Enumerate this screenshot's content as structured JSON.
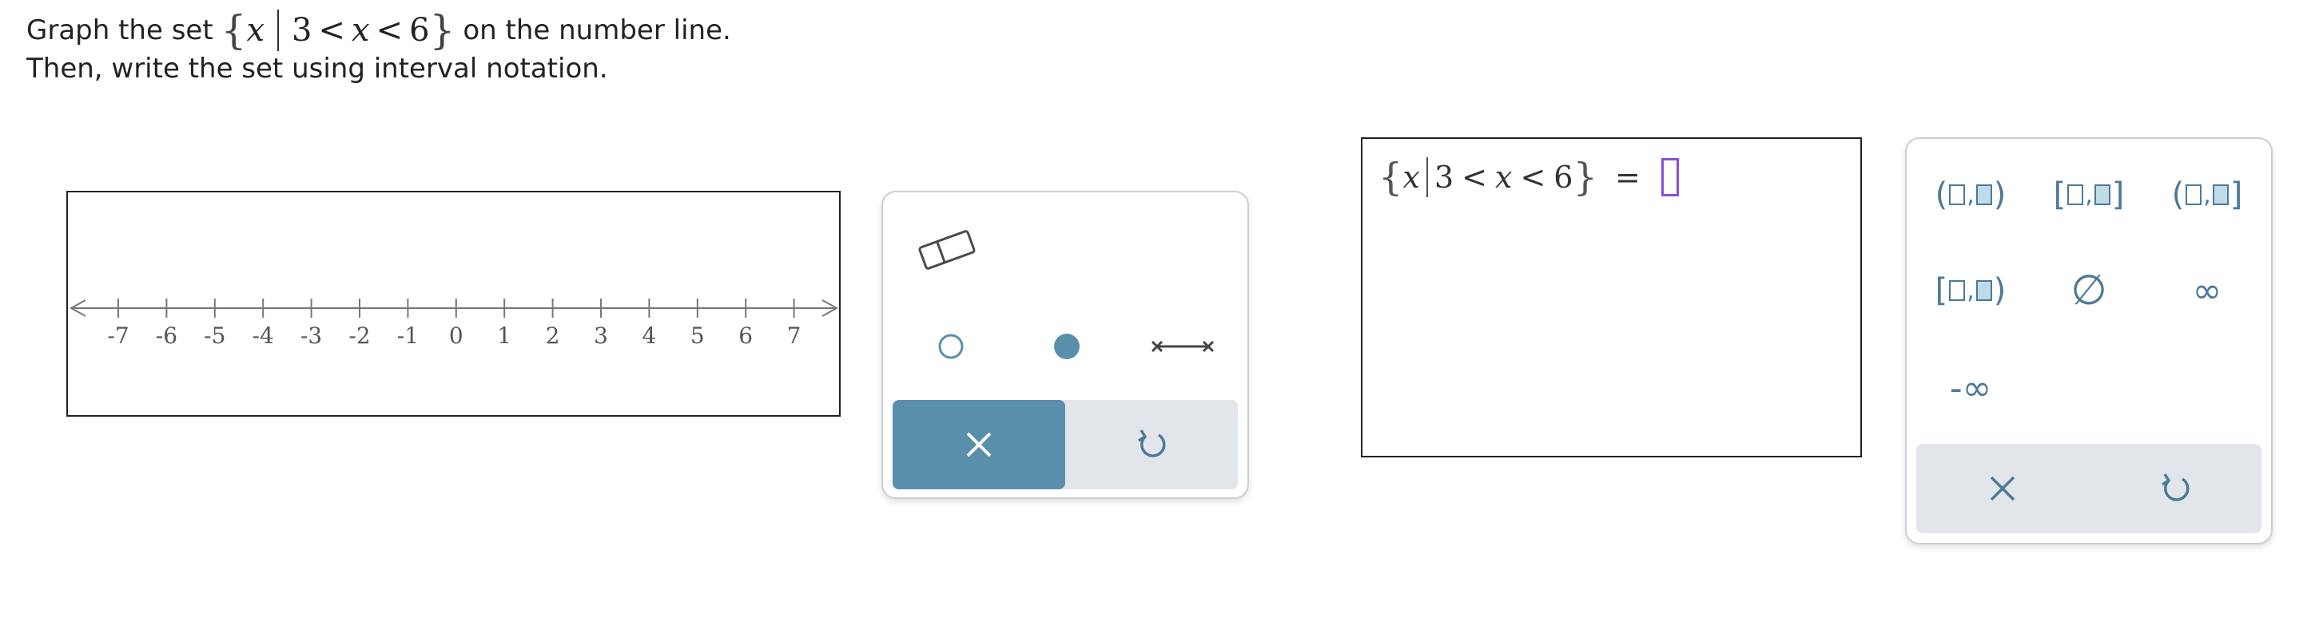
{
  "question": {
    "line1_prefix": "Graph the set",
    "set_var": "x",
    "set_lower": "3",
    "set_lt1": "<",
    "set_var2": "x",
    "set_lt2": "<",
    "set_upper": "6",
    "line1_suffix": "on the number line.",
    "line2": "Then, write the set using interval notation."
  },
  "number_line": {
    "ticks": [
      "-7",
      "-6",
      "-5",
      "-4",
      "-3",
      "-2",
      "-1",
      "0",
      "1",
      "2",
      "3",
      "4",
      "5",
      "6",
      "7"
    ]
  },
  "graph_tools": {
    "eraser_icon": "eraser-icon",
    "open_point_icon": "open-circle-icon",
    "closed_point_icon": "filled-circle-icon",
    "segment_icon": "segment-icon",
    "clear_icon": "close-icon",
    "undo_icon": "undo-icon",
    "accent_color": "#5a8fab"
  },
  "answer": {
    "var": "x",
    "lower": "3",
    "lt1": "<",
    "var2": "x",
    "lt2": "<",
    "upper": "6",
    "equals": "=",
    "slot_value": ""
  },
  "keypad": {
    "keys": [
      {
        "name": "open-open-interval",
        "left": "(",
        "right": ")"
      },
      {
        "name": "closed-closed-interval",
        "left": "[",
        "right": "]"
      },
      {
        "name": "open-closed-interval",
        "left": "(",
        "right": "]"
      },
      {
        "name": "closed-open-interval",
        "left": "[",
        "right": ")"
      },
      {
        "name": "empty-set",
        "label": "∅"
      },
      {
        "name": "infinity",
        "label": "∞"
      },
      {
        "name": "negative-infinity",
        "label": "-∞"
      }
    ],
    "clear_icon": "close-icon",
    "undo_icon": "undo-icon",
    "key_color": "#4c7a98"
  }
}
